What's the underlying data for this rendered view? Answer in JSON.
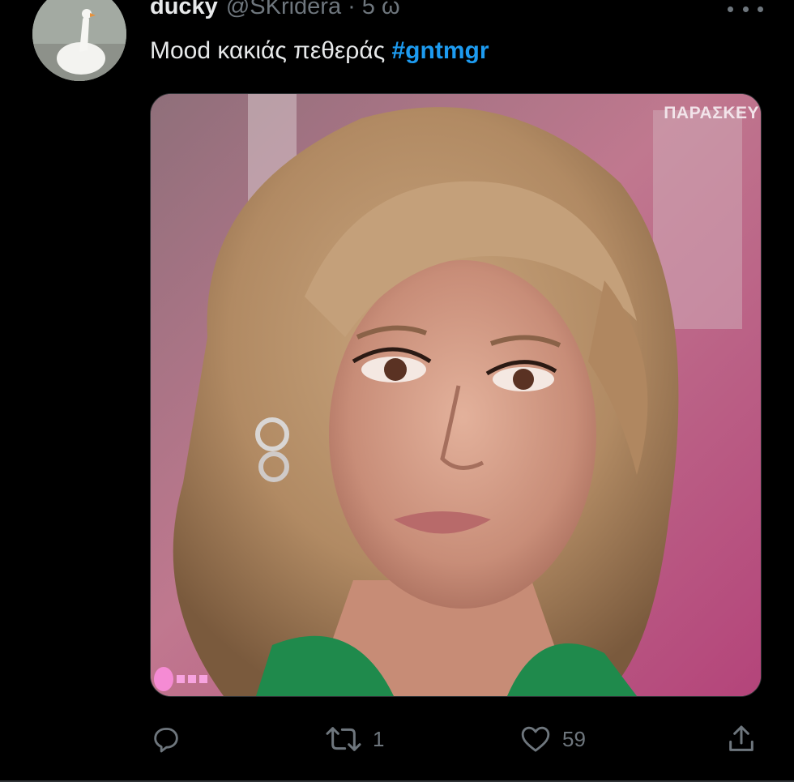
{
  "tweet": {
    "author_name": "ducky",
    "author_handle": "@SKridera",
    "separator": "·",
    "time": "5 ω",
    "text_plain": "Mood κακιάς πεθεράς ",
    "hashtag": "#gntmgr",
    "media": {
      "watermark": "ΠΑΡΑΣΚΕΥ",
      "description_icon": "portrait-photo"
    }
  },
  "actions": {
    "reply_count": "",
    "retweet_count": "1",
    "like_count": "59"
  },
  "colors": {
    "background": "#000000",
    "text": "#e7e9ea",
    "muted": "#6e767d",
    "accent": "#1d9bf0"
  }
}
